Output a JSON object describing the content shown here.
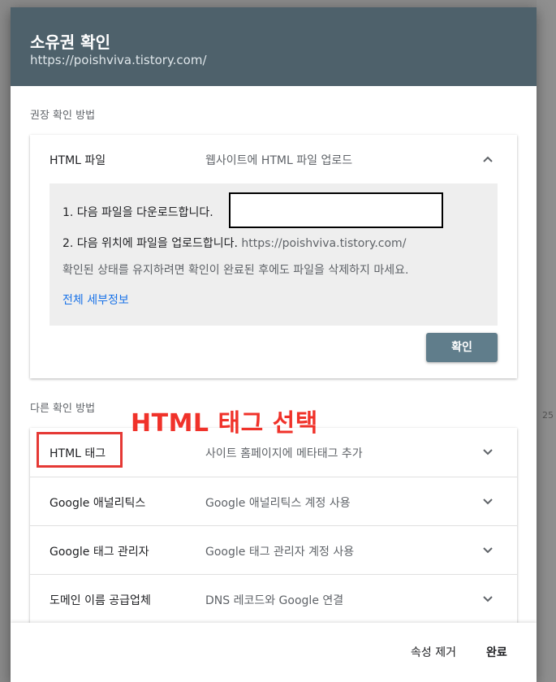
{
  "dialog": {
    "title": "소유권 확인",
    "url": "https://poishviva.tistory.com/"
  },
  "recommended": {
    "section_label": "권장 확인 방법",
    "method": {
      "name": "HTML 파일",
      "description": "웹사이트에 HTML 파일 업로드",
      "expanded": true,
      "step1": "1. 다음 파일을 다운로드합니다.",
      "step2_prefix": "2. 다음 위치에 파일을 업로드합니다.",
      "step2_url": "https://poishviva.tistory.com/",
      "note": "확인된 상태를 유지하려면 확인이 완료된 후에도 파일을 삭제하지 마세요.",
      "details_link": "전체 세부정보",
      "confirm_button": "확인"
    }
  },
  "other": {
    "section_label": "다른 확인 방법",
    "methods": [
      {
        "name": "HTML 태그",
        "description": "사이트 홈페이지에 메타태그 추가"
      },
      {
        "name": "Google 애널리틱스",
        "description": "Google 애널리틱스 계정 사용"
      },
      {
        "name": "Google 태그 관리자",
        "description": "Google 태그 관리자 계정 사용"
      },
      {
        "name": "도메인 이름 공급업체",
        "description": "DNS 레코드와 Google 연결"
      }
    ]
  },
  "annotation": {
    "text": "HTML 태그 선택",
    "color": "#f0322a"
  },
  "footer": {
    "remove_property": "속성 제거",
    "done": "완료"
  },
  "background": {
    "value_right": "25",
    "value_bottom": "200"
  },
  "colors": {
    "header": "#4e616b",
    "confirm_button": "#607d8b",
    "link": "#1a73e8"
  }
}
